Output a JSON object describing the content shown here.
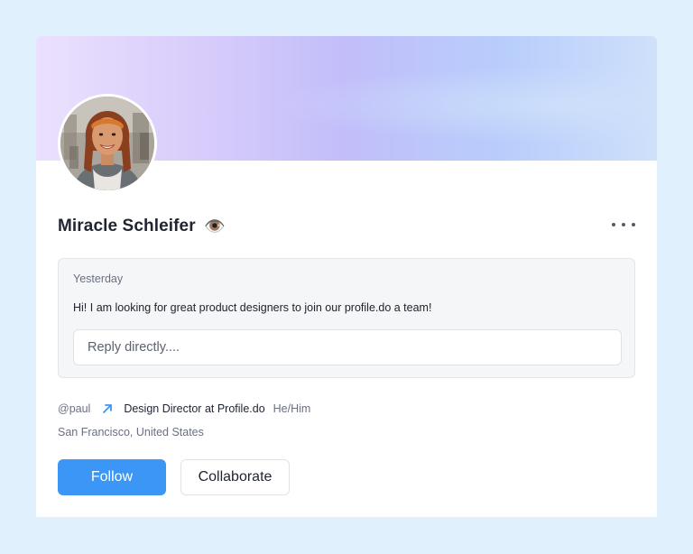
{
  "profile": {
    "name": "Miracle Schleifer",
    "name_emoji": "👁️",
    "handle": "@paul",
    "role": "Design Director at Profile.do",
    "pronouns": "He/Him",
    "location": "San Francisco, United States",
    "avatar_icon": "avatar-photo"
  },
  "message": {
    "time": "Yesterday",
    "text": "Hi! I am looking for great product designers to join our profile.do a team!",
    "reply_placeholder": "Reply directly...."
  },
  "actions": {
    "follow_label": "Follow",
    "collaborate_label": "Collaborate",
    "more_icon": "more-horizontal-icon"
  },
  "colors": {
    "background": "#e1f0fd",
    "accent": "#3b96f5",
    "link_arrow": "#3b96f5"
  }
}
